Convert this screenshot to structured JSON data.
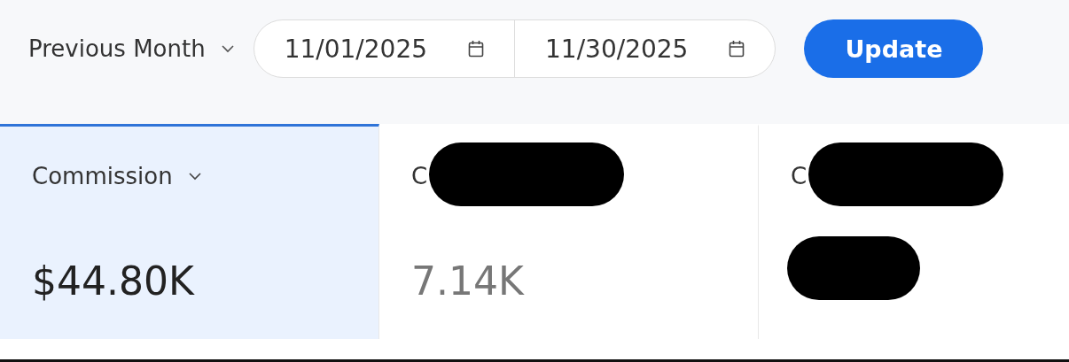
{
  "toolbar": {
    "period": {
      "value": "Previous Month"
    },
    "start_date": {
      "value": "11/01/2025"
    },
    "end_date": {
      "value": "11/30/2025"
    },
    "update_button": {
      "label": "Update"
    }
  },
  "metric_tabs": [
    {
      "label": "Commission",
      "value": "$44.80K",
      "selected": true,
      "has_dropdown": true,
      "label_redacted": false,
      "value_redacted": false
    },
    {
      "label": "C",
      "value": "7.14K",
      "selected": false,
      "has_dropdown": false,
      "label_redacted": true,
      "value_redacted": false
    },
    {
      "label": "C",
      "selected": false,
      "has_dropdown": false,
      "label_redacted": true,
      "value_redacted": true
    }
  ]
}
